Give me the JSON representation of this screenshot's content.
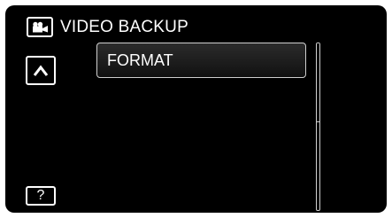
{
  "header": {
    "title": "VIDEO BACKUP",
    "mode_icon": "video-camera-icon"
  },
  "nav": {
    "up_icon": "chevron-up-icon",
    "help_label": "?"
  },
  "menu": {
    "items": [
      {
        "label": "FORMAT"
      }
    ]
  },
  "scrollbar": {
    "position_fraction": 0.0,
    "visible_fraction": 0.47
  },
  "colors": {
    "background": "#000000",
    "foreground": "#ffffff",
    "border": "#cfcfcf"
  }
}
